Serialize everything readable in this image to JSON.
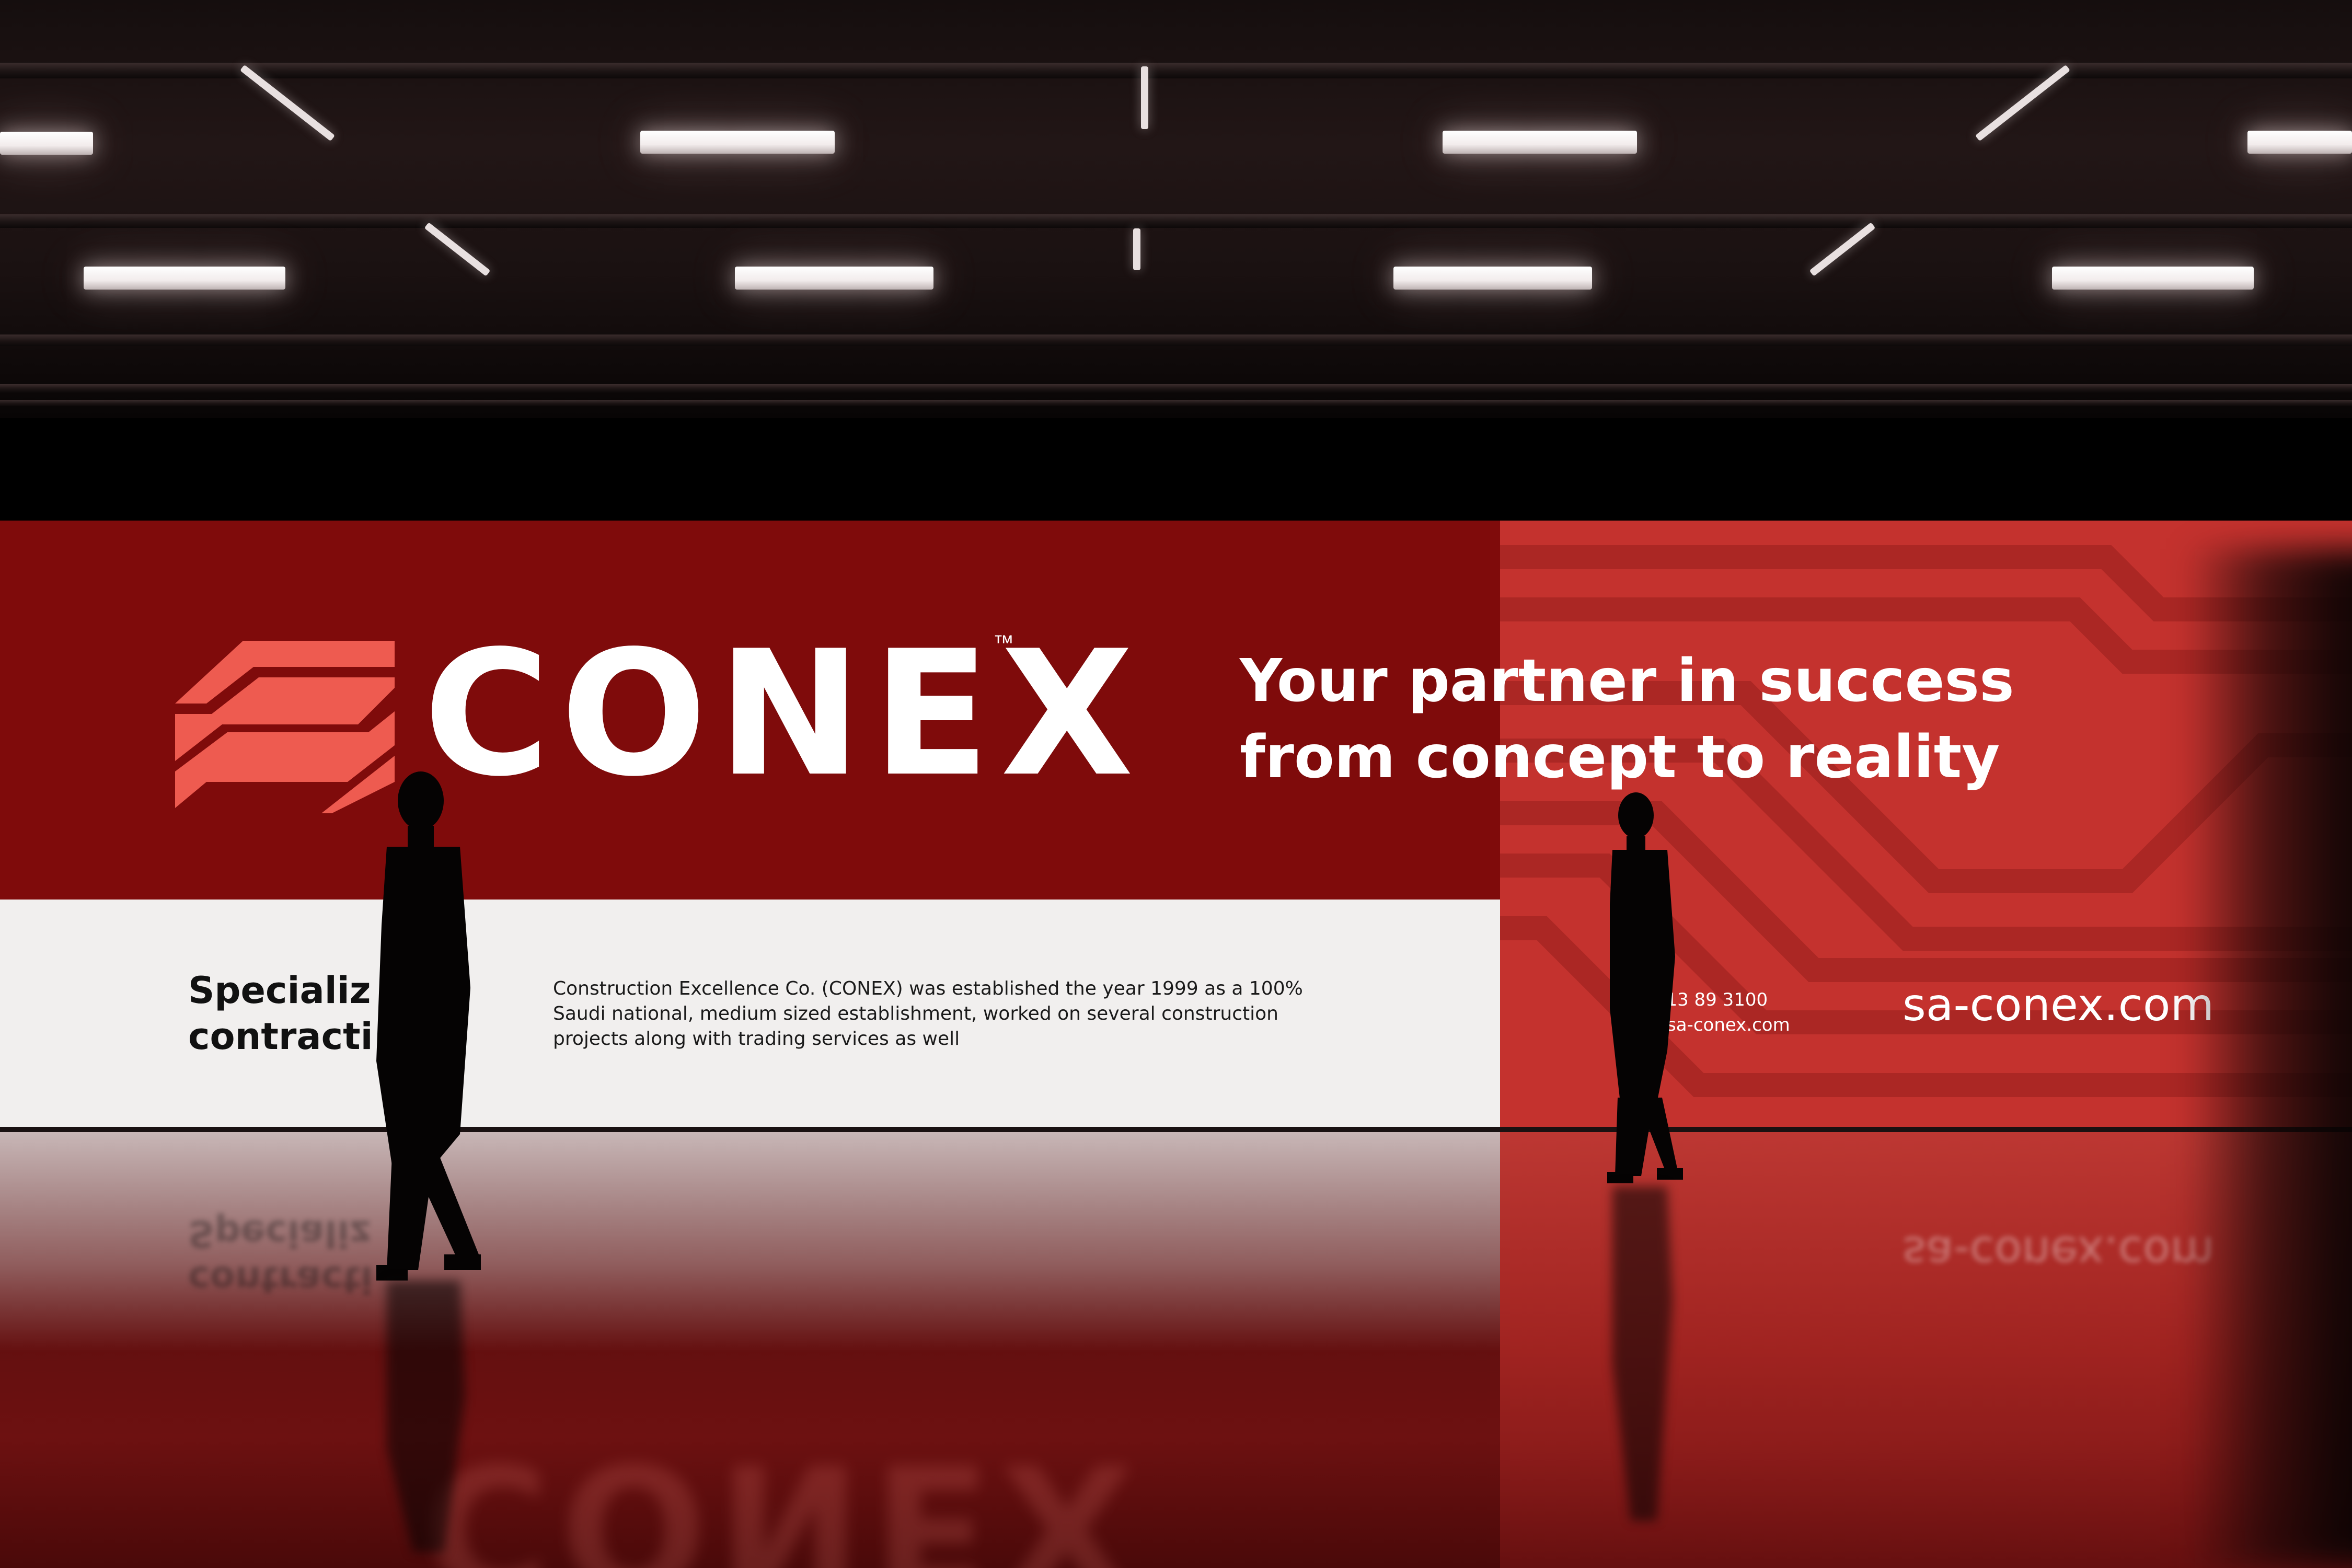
{
  "billboard": {
    "logo_word": "CONEX",
    "logo_tm": "™",
    "tagline_line1": "Your partner in success",
    "tagline_line2": "from concept to reality",
    "spec_line1": "Specializ",
    "spec_line2": "contracti",
    "about": "Construction Excellence Co. (CONEX) was established the year 1999 as a 100% Saudi national, medium sized establishment, worked on several construction projects along with trading services as well",
    "phone": "6 13 89 3100",
    "email": "@sa-conex.com",
    "website": "sa-conex.com"
  },
  "colors": {
    "brand_dark_red": "#7f0b0b",
    "brand_red": "#c4322e",
    "logo_coral": "#ee5b50",
    "panel_white": "#f1efee"
  }
}
